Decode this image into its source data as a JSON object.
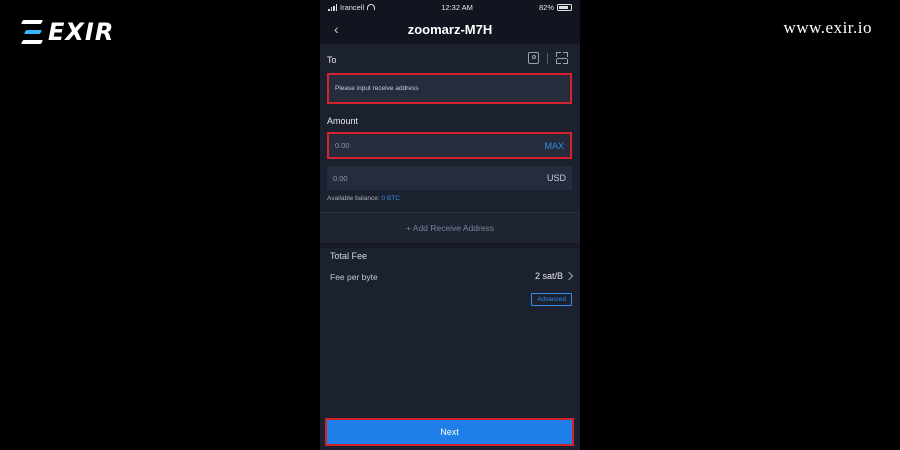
{
  "brand": {
    "logo_text": "EXIR",
    "site": "www.exir.io"
  },
  "status_bar": {
    "carrier": "Irancell",
    "time": "12:32 AM",
    "battery": "82%"
  },
  "header": {
    "title": "zoomarz-M7H"
  },
  "to": {
    "label": "To",
    "placeholder": "Please input receive address"
  },
  "amount": {
    "label": "Amount",
    "btc_value": "0.00",
    "max_label": "MAX",
    "usd_value": "0.00",
    "usd_label": "USD"
  },
  "balance": {
    "label": "Available balance:",
    "value": "0 BTC"
  },
  "add_address": {
    "label": "+ Add Receive Address"
  },
  "fee": {
    "title": "Total Fee",
    "per_byte_label": "Fee per byte",
    "per_byte_value": "2 sat/B",
    "advanced_label": "Advanced"
  },
  "next": {
    "label": "Next"
  },
  "colors": {
    "accent": "#1e7fe8",
    "highlight": "#d2232f",
    "background": "#1c2130"
  }
}
